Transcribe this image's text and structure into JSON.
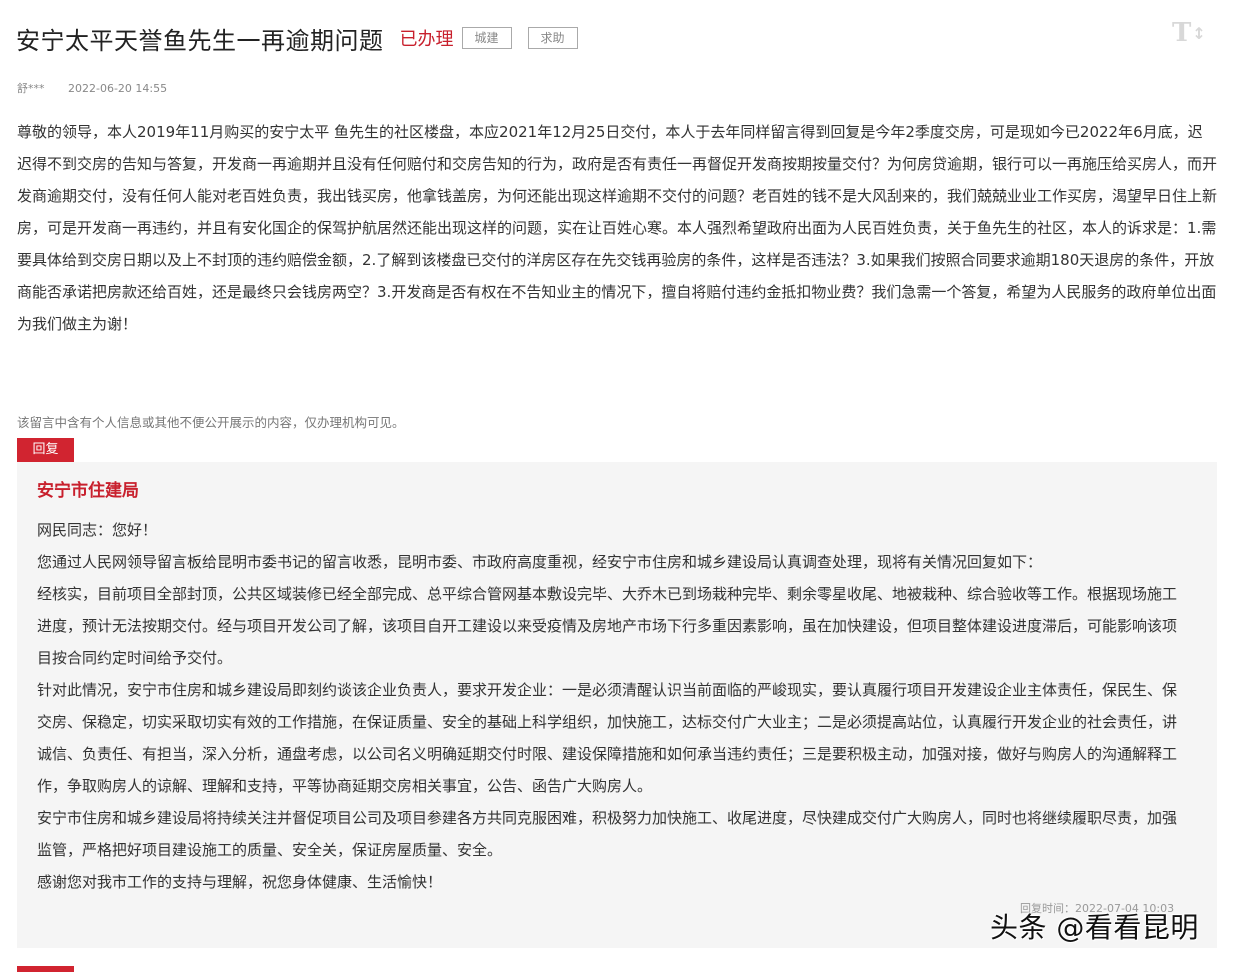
{
  "header": {
    "title": "安宁太平天誉鱼先生一再逾期问题",
    "status": "已办理",
    "tags": [
      "城建",
      "求助"
    ],
    "font_toggle_label": "T",
    "font_toggle_arrow": "↕"
  },
  "meta": {
    "author": "舒***",
    "date": "2022-06-20 14:55"
  },
  "message": {
    "body": "尊敬的领导，本人2019年11月购买的安宁太平 鱼先生的社区楼盘，本应2021年12月25日交付，本人于去年同样留言得到回复是今年2季度交房，可是现如今已2022年6月底，迟迟得不到交房的告知与答复，开发商一再逾期并且没有任何赔付和交房告知的行为，政府是否有责任一再督促开发商按期按量交付？为何房贷逾期，银行可以一再施压给买房人，而开发商逾期交付，没有任何人能对老百姓负责，我出钱买房，他拿钱盖房，为何还能出现这样逾期不交付的问题？老百姓的钱不是大风刮来的，我们兢兢业业工作买房，渴望早日住上新房，可是开发商一再违约，并且有安化国企的保驾护航居然还能出现这样的问题，实在让百姓心寒。本人强烈希望政府出面为人民百姓负责，关于鱼先生的社区，本人的诉求是：1.需要具体给到交房日期以及上不封顶的违约赔偿金额，2.了解到该楼盘已交付的洋房区存在先交钱再验房的条件，这样是否违法？3.如果我们按照合同要求逾期180天退房的条件，开放商能否承诺把房款还给百姓，还是最终只会钱房两空？3.开发商是否有权在不告知业主的情况下，擅自将赔付违约金抵扣物业费？我们急需一个答复，希望为人民服务的政府单位出面为我们做主为谢！",
    "privacy_note": "该留言中含有个人信息或其他不便公开展示的内容，仅办理机构可见。"
  },
  "reply": {
    "label": "回复",
    "org": "安宁市住建局",
    "paragraphs": [
      "网民同志：您好！",
      "您通过人民网领导留言板给昆明市委书记的留言收悉，昆明市委、市政府高度重视，经安宁市住房和城乡建设局认真调查处理，现将有关情况回复如下：",
      "经核实，目前项目全部封顶，公共区域装修已经全部完成、总平综合管网基本敷设完毕、大乔木已到场栽种完毕、剩余零星收尾、地被栽种、综合验收等工作。根据现场施工进度，预计无法按期交付。经与项目开发公司了解，该项目自开工建设以来受疫情及房地产市场下行多重因素影响，虽在加快建设，但项目整体建设进度滞后，可能影响该项目按合同约定时间给予交付。",
      "针对此情况，安宁市住房和城乡建设局即刻约谈该企业负责人，要求开发企业：一是必须清醒认识当前面临的严峻现实，要认真履行项目开发建设企业主体责任，保民生、保交房、保稳定，切实采取切实有效的工作措施，在保证质量、安全的基础上科学组织，加快施工，达标交付广大业主；二是必须提高站位，认真履行开发企业的社会责任，讲诚信、负责任、有担当，深入分析，通盘考虑，以公司名义明确延期交付时限、建设保障措施和如何承当违约责任；三是要积极主动，加强对接，做好与购房人的沟通解释工作，争取购房人的谅解、理解和支持，平等协商延期交房相关事宜，公告、函告广大购房人。",
      "安宁市住房和城乡建设局将持续关注并督促项目公司及项目参建各方共同克服困难，积极努力加快施工、收尾进度，尽快建成交付广大购房人，同时也将继续履职尽责，加强监管，严格把好项目建设施工的质量、安全关，保证房屋质量、安全。",
      "感谢您对我市工作的支持与理解，祝您身体健康、生活愉快！"
    ],
    "time": "回复时间：2022-07-04 10:03"
  },
  "watermark": "头条 @看看昆明",
  "colors": {
    "accent_red": "#d12430",
    "reply_bg": "#f5f5f5"
  }
}
